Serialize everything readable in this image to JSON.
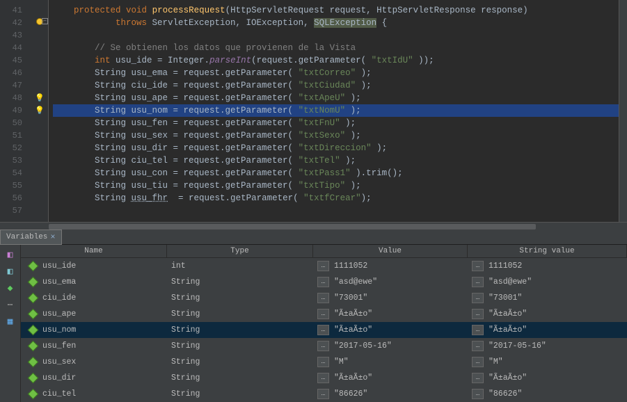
{
  "editor": {
    "startLine": 41,
    "lines": [
      {
        "n": 41,
        "html": "    <span class='kw-orange'>protected void</span> <span class='kw-method'>processRequest</span>(HttpServletRequest request, HttpServletResponse response)"
      },
      {
        "n": 42,
        "html": "            <span class='kw-orange'>throws</span> ServletException, IOException, <span class='kw-highlight'>SQLException</span> {"
      },
      {
        "n": 43,
        "html": ""
      },
      {
        "n": 44,
        "html": "        <span class='kw-comment'>// Se obtienen los datos que provienen de la Vista</span>"
      },
      {
        "n": 45,
        "html": "        <span class='kw-orange'>int</span> usu_ide = Integer.<span class='kw-italic'>parseInt</span>(request.getParameter( <span class='kw-str'>\"txtIdU\"</span> ));"
      },
      {
        "n": 46,
        "html": "        String usu_ema = request.getParameter( <span class='kw-str'>\"txtCorreo\"</span> );"
      },
      {
        "n": 47,
        "html": "        String ciu_ide = request.getParameter( <span class='kw-str'>\"txtCiudad\"</span> );"
      },
      {
        "n": 48,
        "html": "        String usu_ape = request.getParameter( <span class='kw-str'>\"txtApeU\"</span> );"
      },
      {
        "n": 49,
        "html": "<span class='kw-selbg'>        String usu_nom = request.getParameter( <span class='kw-str'>\"txtNomU\"</span> );</span>"
      },
      {
        "n": 50,
        "html": "        String usu_fen = request.getParameter( <span class='kw-str'>\"txtFnU\"</span> );"
      },
      {
        "n": 51,
        "html": "        String usu_sex = request.getParameter( <span class='kw-str'>\"txtSexo\"</span> );"
      },
      {
        "n": 52,
        "html": "        String usu_dir = request.getParameter( <span class='kw-str'>\"txtDireccion\"</span> );"
      },
      {
        "n": 53,
        "html": "        String ciu_tel = request.getParameter( <span class='kw-str'>\"txtTel\"</span> );"
      },
      {
        "n": 54,
        "html": "        String usu_con = request.getParameter( <span class='kw-str'>\"txtPass1\"</span> ).trim();"
      },
      {
        "n": 55,
        "html": "        String usu_tiu = request.getParameter( <span class='kw-str'>\"txtTipo\"</span> );"
      },
      {
        "n": 56,
        "html": "        String <span style='text-decoration:underline dotted'>usu_fhr</span>  = request.getParameter( <span class='kw-str'>\"txtfCrear\"</span>);"
      },
      {
        "n": 57,
        "html": ""
      }
    ]
  },
  "panelTab": "Variables",
  "cols": {
    "name": "Name",
    "type": "Type",
    "value": "Value",
    "strvalue": "String value"
  },
  "vars": [
    {
      "name": "usu_ide",
      "type": "int",
      "value": "1111052",
      "strvalue": "1111052",
      "sel": false
    },
    {
      "name": "usu_ema",
      "type": "String",
      "value": "\"asd@ewe\"",
      "strvalue": "\"asd@ewe\"",
      "sel": false
    },
    {
      "name": "ciu_ide",
      "type": "String",
      "value": "\"73001\"",
      "strvalue": "\"73001\"",
      "sel": false
    },
    {
      "name": "usu_ape",
      "type": "String",
      "value": "\"Ã±aÃ±o\"",
      "strvalue": "\"Ã±aÃ±o\"",
      "sel": false
    },
    {
      "name": "usu_nom",
      "type": "String",
      "value": "\"Ã±aÃ±o\"",
      "strvalue": "\"Ã±aÃ±o\"",
      "sel": true
    },
    {
      "name": "usu_fen",
      "type": "String",
      "value": "\"2017-05-16\"",
      "strvalue": "\"2017-05-16\"",
      "sel": false
    },
    {
      "name": "usu_sex",
      "type": "String",
      "value": "\"M\"",
      "strvalue": "\"M\"",
      "sel": false
    },
    {
      "name": "usu_dir",
      "type": "String",
      "value": "\"Ã±aÃ±o\"",
      "strvalue": "\"Ã±aÃ±o\"",
      "sel": false
    },
    {
      "name": "ciu_tel",
      "type": "String",
      "value": "\"86626\"",
      "strvalue": "\"86626\"",
      "sel": false
    }
  ]
}
